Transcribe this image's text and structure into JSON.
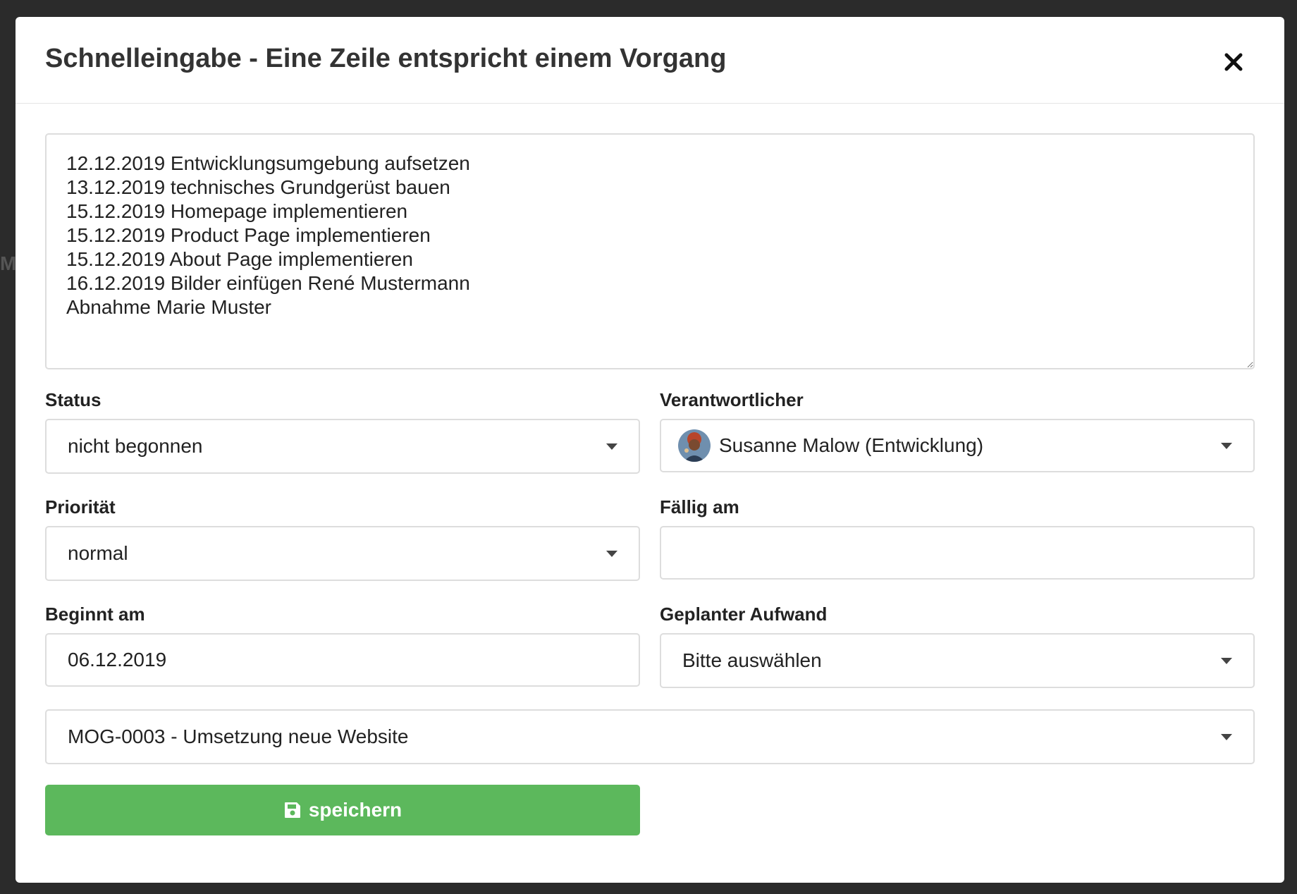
{
  "modal": {
    "title": "Schnelleingabe - Eine Zeile entspricht einem Vorgang",
    "close_icon": "close-icon"
  },
  "quick_input": {
    "value": "12.12.2019 Entwicklungsumgebung aufsetzen\n13.12.2019 technisches Grundgerüst bauen\n15.12.2019 Homepage implementieren\n15.12.2019 Product Page implementieren\n15.12.2019 About Page implementieren\n16.12.2019 Bilder einfügen René Mustermann\nAbnahme Marie Muster"
  },
  "form": {
    "status": {
      "label": "Status",
      "value": "nicht begonnen"
    },
    "responsible": {
      "label": "Verantwortlicher",
      "value": "Susanne Malow (Entwicklung)"
    },
    "priority": {
      "label": "Priorität",
      "value": "normal"
    },
    "due": {
      "label": "Fällig am",
      "value": ""
    },
    "start": {
      "label": "Beginnt am",
      "value": "06.12.2019"
    },
    "effort": {
      "label": "Geplanter Aufwand",
      "value": "Bitte auswählen"
    },
    "project": {
      "value": "MOG-0003 - Umsetzung neue Website"
    }
  },
  "save_button": {
    "label": "speichern",
    "icon": "floppy-disk-icon",
    "color": "#5cb85c"
  }
}
